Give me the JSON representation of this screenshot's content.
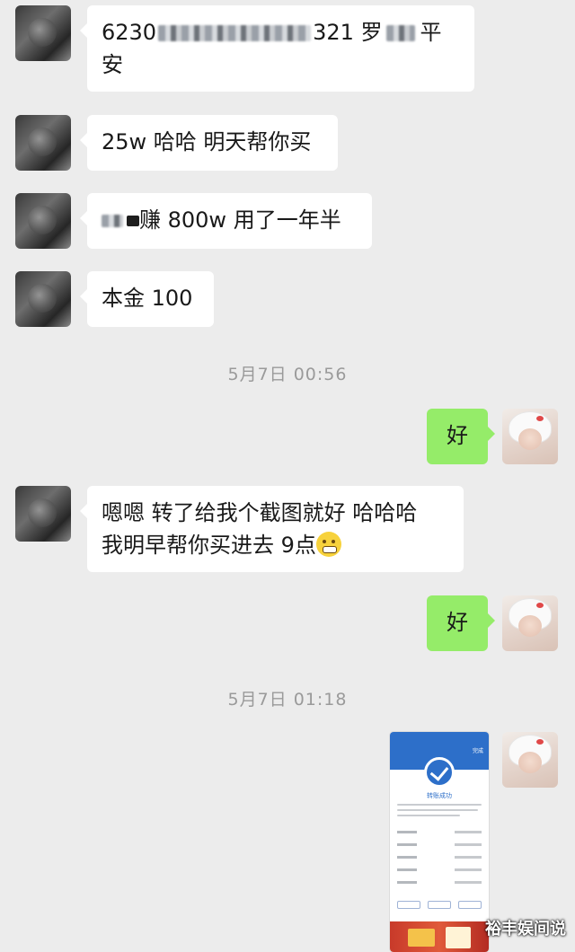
{
  "messages": {
    "m1": {
      "prefix": "6230",
      "suffix": "321 罗",
      "tail": "平",
      "line2": "安"
    },
    "m2": {
      "text": "25w 哈哈 明天帮你买"
    },
    "m3": {
      "text": "赚 800w 用了一年半"
    },
    "m4": {
      "text": "本金 100"
    },
    "ts1": {
      "text": "5月7日 00:56"
    },
    "m5": {
      "text": "好"
    },
    "m6": {
      "line1": "嗯嗯 转了给我个截图就好 哈哈哈",
      "line2": "我明早帮你买进去 9点"
    },
    "m7": {
      "text": "好"
    },
    "ts2": {
      "text": "5月7日 01:18"
    }
  },
  "screenshot": {
    "title": "转账成功",
    "done_label": "完成"
  },
  "watermark": "裕丰娱间说",
  "colors": {
    "background": "#ececec",
    "left_bubble": "#ffffff",
    "right_bubble": "#95ec69",
    "timestamp": "#9a9a9a"
  },
  "icons": {
    "left_avatar": "cat-avatar",
    "right_avatar": "girl-avatar",
    "emoji": "grimace-emoji",
    "check": "check-icon"
  }
}
